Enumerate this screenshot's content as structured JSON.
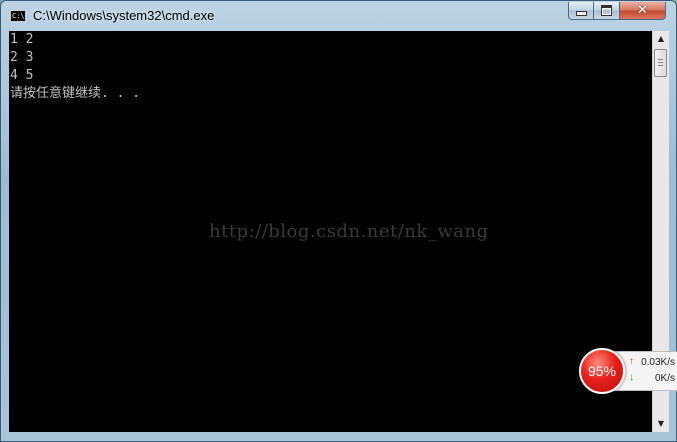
{
  "window": {
    "title": "C:\\Windows\\system32\\cmd.exe",
    "icon": "cmd-app-icon"
  },
  "console": {
    "lines": [
      "1 2",
      "2 3",
      "4 5",
      "请按任意键继续. . ."
    ],
    "watermark": "http://blog.csdn.net/nk_wang"
  },
  "net_monitor": {
    "percent": "95%",
    "upload": "0.03K/s",
    "download": "0K/s"
  }
}
